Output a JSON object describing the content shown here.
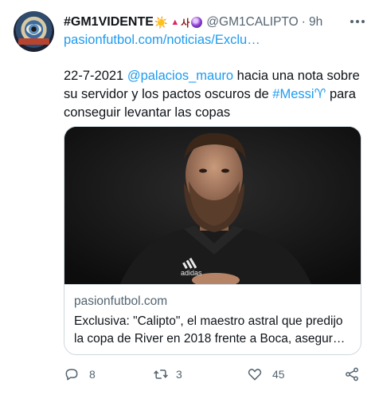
{
  "author": {
    "display_name": "#GM1VIDENTE",
    "emojis": {
      "sun": "☀️",
      "triangle": "▲",
      "hangul": "사"
    },
    "handle": "@GM1CALIPTO",
    "separator": "·",
    "time": "9h",
    "link": "pasionfutbol.com/noticias/Exclu…"
  },
  "tweet": {
    "text_date": "22-7-2021",
    "mention": "@palacios_mauro",
    "text_part1": " hacia una nota sobre su servidor y los pactos oscuros de ",
    "hashtag": "#Messi",
    "aries": "♈",
    "text_part2": " para conseguir levantar las copas"
  },
  "card": {
    "domain": "pasionfutbol.com",
    "title_line1": "Exclusiva: \"Calipto\", el maestro astral que predijo",
    "title_line2": "la copa de River en 2018 frente a Boca, asegura…",
    "image_brand": "adidas"
  },
  "actions": {
    "reply_count": "8",
    "retweet_count": "3",
    "like_count": "45",
    "icons": [
      "reply-icon",
      "retweet-icon",
      "like-icon",
      "share-icon"
    ]
  },
  "colors": {
    "accent": "#1d9bf0",
    "muted": "#536471",
    "text": "#0f1419",
    "border": "#cfd9de"
  }
}
